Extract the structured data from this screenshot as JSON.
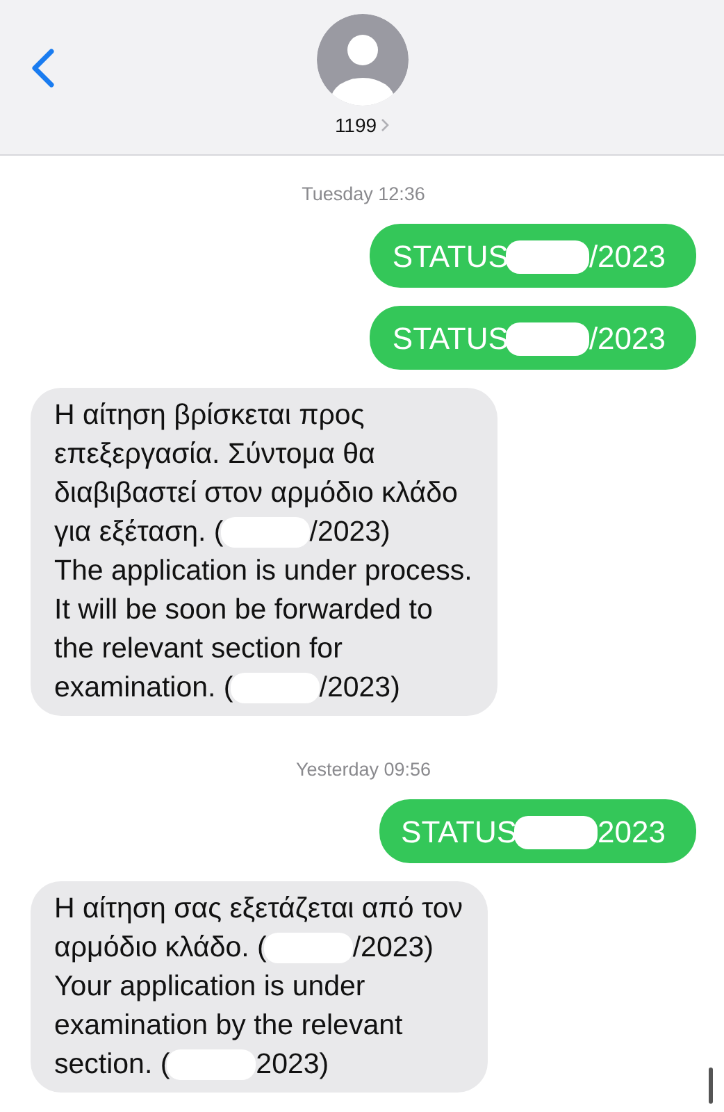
{
  "header": {
    "contact": "1199"
  },
  "thread": [
    {
      "kind": "timestamp",
      "text": "Tuesday 12:36"
    },
    {
      "kind": "outgoing",
      "lines": [
        [
          {
            "kind": "text",
            "text": "STATUS"
          },
          {
            "kind": "redacted"
          },
          {
            "kind": "text",
            "text": "/2023"
          }
        ]
      ]
    },
    {
      "kind": "outgoing",
      "lines": [
        [
          {
            "kind": "text",
            "text": "STATUS"
          },
          {
            "kind": "redacted"
          },
          {
            "kind": "text",
            "text": "/2023"
          }
        ]
      ]
    },
    {
      "kind": "incoming",
      "lines": [
        [
          {
            "kind": "text",
            "text": "Η αίτηση βρίσκεται προς"
          }
        ],
        [
          {
            "kind": "text",
            "text": "επεξεργασία. Σύντομα θα"
          }
        ],
        [
          {
            "kind": "text",
            "text": "διαβιβαστεί στον αρμόδιο κλάδο"
          }
        ],
        [
          {
            "kind": "text",
            "text": "για εξέταση. ("
          },
          {
            "kind": "redacted"
          },
          {
            "kind": "text",
            "text": "/2023)"
          }
        ],
        [
          {
            "kind": "text",
            "text": "The application is under process."
          }
        ],
        [
          {
            "kind": "text",
            "text": "It will be soon be forwarded to"
          }
        ],
        [
          {
            "kind": "text",
            "text": "the relevant section for"
          }
        ],
        [
          {
            "kind": "text",
            "text": "examination. ("
          },
          {
            "kind": "redacted"
          },
          {
            "kind": "text",
            "text": "/2023)"
          }
        ]
      ]
    },
    {
      "kind": "timestamp",
      "text": "Yesterday 09:56"
    },
    {
      "kind": "outgoing",
      "lines": [
        [
          {
            "kind": "text",
            "text": "STATUS"
          },
          {
            "kind": "redacted"
          },
          {
            "kind": "text",
            "text": "2023"
          }
        ]
      ]
    },
    {
      "kind": "incoming",
      "lines": [
        [
          {
            "kind": "text",
            "text": "Η αίτηση σας εξετάζεται από τον"
          }
        ],
        [
          {
            "kind": "text",
            "text": "αρμόδιο κλάδο. ("
          },
          {
            "kind": "redacted"
          },
          {
            "kind": "text",
            "text": "/2023)"
          }
        ],
        [
          {
            "kind": "text",
            "text": "Your application is under"
          }
        ],
        [
          {
            "kind": "text",
            "text": "examination by the relevant"
          }
        ],
        [
          {
            "kind": "text",
            "text": "section. ("
          },
          {
            "kind": "redacted"
          },
          {
            "kind": "text",
            "text": "2023)"
          }
        ]
      ]
    }
  ]
}
